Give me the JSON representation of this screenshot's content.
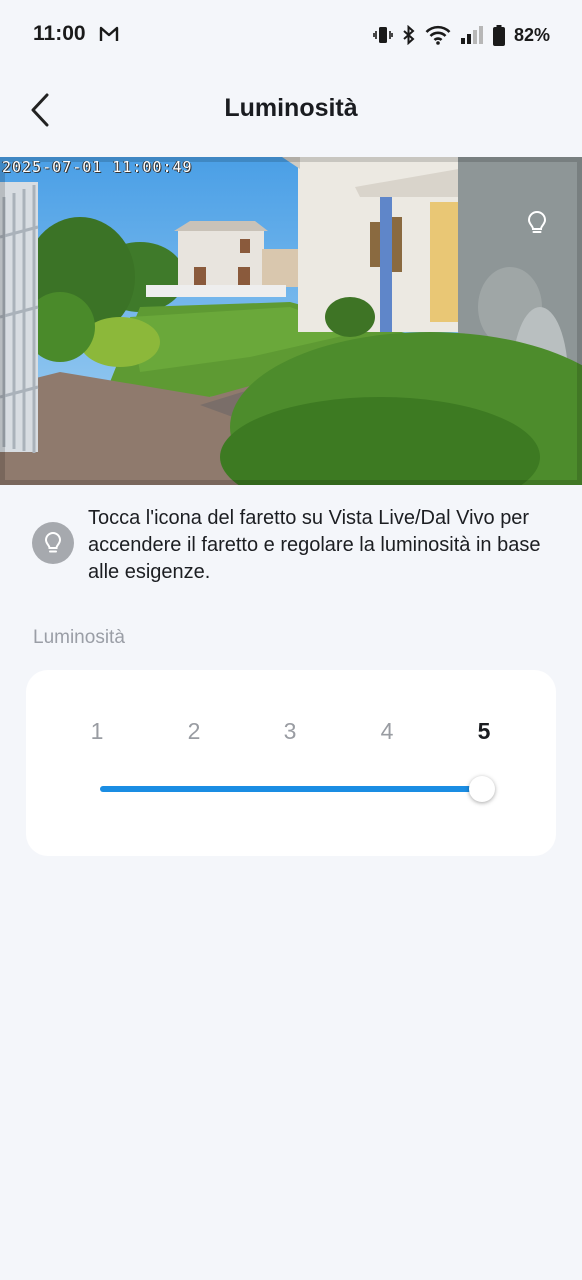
{
  "status_bar": {
    "time": "11:00",
    "notification_icon": "gmail-icon",
    "icons": [
      "vibrate-icon",
      "bluetooth-icon",
      "wifi-icon",
      "signal-icon",
      "battery-icon"
    ],
    "battery_percent": "82%"
  },
  "header": {
    "title": "Luminosità",
    "back_icon": "chevron-left-icon"
  },
  "camera": {
    "timestamp": "2025-07-01 11:00:49",
    "overlay_icon": "lightbulb-icon"
  },
  "info": {
    "icon": "lightbulb-icon",
    "text": "Tocca l'icona del faretto su Vista Live/Dal Vivo per accendere il faretto e regolare la luminosità in base alle esigenze."
  },
  "brightness": {
    "section_label": "Luminosità",
    "levels": [
      "1",
      "2",
      "3",
      "4",
      "5"
    ],
    "selected_level": 5,
    "min": 1,
    "max": 5,
    "accent_color": "#1a8de3"
  }
}
